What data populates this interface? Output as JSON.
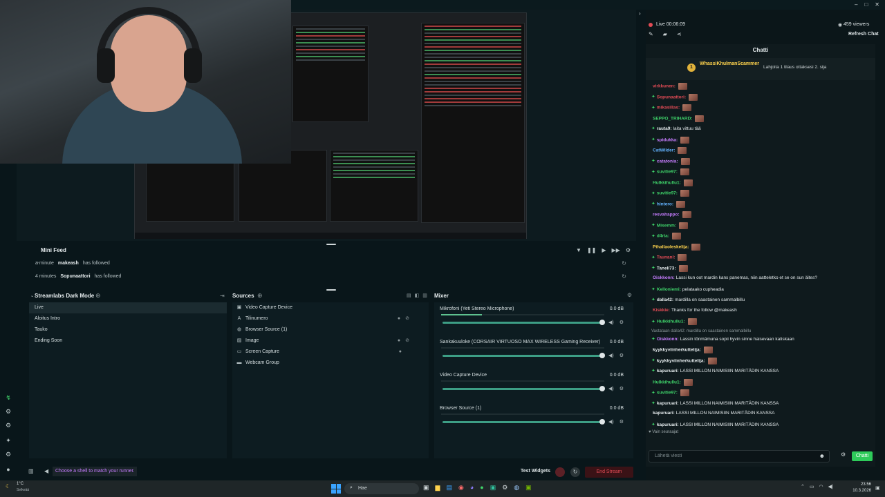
{
  "window": {
    "controls": [
      "–",
      "□",
      "✕"
    ]
  },
  "preview": {},
  "minifeed": {
    "title": "Mini Feed",
    "items": [
      {
        "time": "a minute",
        "user": "makeash",
        "action": "has followed"
      },
      {
        "time": "4 minutes",
        "user": "Sopunaattori",
        "action": "has followed"
      }
    ]
  },
  "scenes": {
    "title": "Streamlabs Dark Mode",
    "items": [
      "Live",
      "Aloitus Intro",
      "Tauko",
      "Ending Soon"
    ]
  },
  "sources": {
    "title": "Sources",
    "items": [
      {
        "label": "Video Capture Device",
        "icon": "camera-icon",
        "glyph": "▣"
      },
      {
        "label": "Tilinumero",
        "icon": "text-icon",
        "glyph": "A"
      },
      {
        "label": "Browser Source (1)",
        "icon": "globe-icon",
        "glyph": "◍"
      },
      {
        "label": "Image",
        "icon": "image-icon",
        "glyph": "▨"
      },
      {
        "label": "Screen Capture",
        "icon": "monitor-icon",
        "glyph": "▭"
      },
      {
        "label": "Webcam Group",
        "icon": "folder-icon",
        "glyph": "▬"
      }
    ]
  },
  "mixer": {
    "title": "Mixer",
    "channels": [
      {
        "name": "Mikrofoni (Yeti Stereo Microphone)",
        "db": "0.0 dB",
        "level": 0.25
      },
      {
        "name": "Sankakuuloke (CORSAIR VIRTUOSO MAX WIRELESS Gaming Receiver)",
        "db": "0.0 dB",
        "level": 0
      },
      {
        "name": "Video Capture Device",
        "db": "0.0 dB",
        "level": 0
      },
      {
        "name": "Browser Source (1)",
        "db": "0.0 dB",
        "level": 0
      }
    ]
  },
  "bottombar": {
    "tip": "Choose a shell to match your runner.",
    "test_widgets": "Test Widgets",
    "end_stream": "End Stream"
  },
  "chat": {
    "live_label": "Live 00:06:09",
    "viewers": "459 viewers",
    "refresh": "Refresh Chat",
    "title": "Chatti",
    "pinned_user": "WhassiKhulmanScammer",
    "pinned_text": "Lahjoita 1 tilaus ottaksesi 2. sija",
    "messages": [
      {
        "user": "virkkunen:",
        "color": "#e24b55",
        "text": "",
        "emote": true
      },
      {
        "user": "Sopunaattori:",
        "color": "#e24b55",
        "text": "",
        "emote": true
      },
      {
        "user": "mikasillas:",
        "color": "#e24b55",
        "text": "",
        "emote": true
      },
      {
        "user": "SEPPO_TRIHARD:",
        "color": "#3fd36a",
        "text": "",
        "emote": true
      },
      {
        "user": "rauta9:",
        "color": "#e6ecee",
        "text": "laita vittuu tää",
        "emote": false
      },
      {
        "user": "spidukka:",
        "color": "#c77dff",
        "text": "",
        "emote": true
      },
      {
        "user": "CatWilder:",
        "color": "#63b3ff",
        "text": "",
        "emote": true
      },
      {
        "user": "catatonia:",
        "color": "#c77dff",
        "text": "",
        "emote": true
      },
      {
        "user": "suvitie97:",
        "color": "#3fd36a",
        "text": "",
        "emote": true
      },
      {
        "user": "Hulkkihullu1:",
        "color": "#3fd36a",
        "text": "",
        "emote": true
      },
      {
        "user": "suvitie97:",
        "color": "#3fd36a",
        "text": "",
        "emote": true
      },
      {
        "user": "hintero:",
        "color": "#63b3ff",
        "text": "",
        "emote": true
      },
      {
        "user": "resvahappo:",
        "color": "#c77dff",
        "text": "",
        "emote": true
      },
      {
        "user": "Misemm:",
        "color": "#3fd36a",
        "text": "",
        "emote": true
      },
      {
        "user": "d4rta:",
        "color": "#3fd36a",
        "text": "",
        "emote": true
      },
      {
        "user": "Pihallaoleskelija:",
        "color": "#ffd34d",
        "text": "",
        "emote": true
      },
      {
        "user": "Taunanl:",
        "color": "#e24b55",
        "text": "",
        "emote": true
      },
      {
        "user": "Taneli73:",
        "color": "#e6ecee",
        "text": "",
        "emote": true
      },
      {
        "user": "Oiskkonn:",
        "color": "#c77dff",
        "text": "Lassi kun oot mardin kans panemas, niin aatteletko et se on sun äites?",
        "emote": false
      },
      {
        "user": "Kelloniemi:",
        "color": "#3fd36a",
        "text": "pelataako cupheadia",
        "emote": false
      },
      {
        "user": "dalla42:",
        "color": "#e6ecee",
        "text": "mardilla on saastainen sammalbillu",
        "emote": false
      },
      {
        "user": "Kiskkie:",
        "color": "#e24b55",
        "text": "Thanks for the follow @makeash",
        "emote": false
      },
      {
        "user": "Hulkkihullu1:",
        "color": "#3fd36a",
        "text": "",
        "emote": true
      },
      {
        "user": "Oiskkonn:",
        "color": "#c77dff",
        "text": "Lassin tönmämuna sopii hyvin sinne haisevaan katiskaan",
        "emote": false
      },
      {
        "user": "kyykkyviinherkuttelija:",
        "color": "#e6ecee",
        "text": "",
        "emote": true
      },
      {
        "user": "kyykkyviinherkuttelija:",
        "color": "#e6ecee",
        "text": "",
        "emote": true
      },
      {
        "user": "kapuruari:",
        "color": "#e6ecee",
        "text": "LASSI MILLON NAIMISIIN MARITÄDIN KANSSA",
        "emote": false
      },
      {
        "user": "Hulkkihullu1:",
        "color": "#3fd36a",
        "text": "",
        "emote": true
      },
      {
        "user": "suvitie97:",
        "color": "#3fd36a",
        "text": "",
        "emote": true
      },
      {
        "user": "kapuruari:",
        "color": "#e6ecee",
        "text": "LASSI MILLON NAIMISIIN MARITÄDIN KANSSA",
        "emote": false
      },
      {
        "user": "kapuruari:",
        "color": "#e6ecee",
        "text": "LASSI MILLON NAIMISIIN MARITÄDIN KANSSA",
        "emote": false
      },
      {
        "user": "kapuruari:",
        "color": "#e6ecee",
        "text": "LASSI MILLON NAIMISIIN MARITÄDIN KANSSA",
        "emote": false
      }
    ],
    "reply_note": "Vastataan dalla42: mardilla on saastainen sammalbillu",
    "follower_mode": "Vain seuraajat",
    "input_placeholder": "Lähetä viesti",
    "send_label": "Chatti"
  },
  "taskbar": {
    "weather": "1°C",
    "weather_sub": "Selkeää",
    "search_placeholder": "Hae",
    "time": "23.56",
    "date": "10.3.2026"
  }
}
